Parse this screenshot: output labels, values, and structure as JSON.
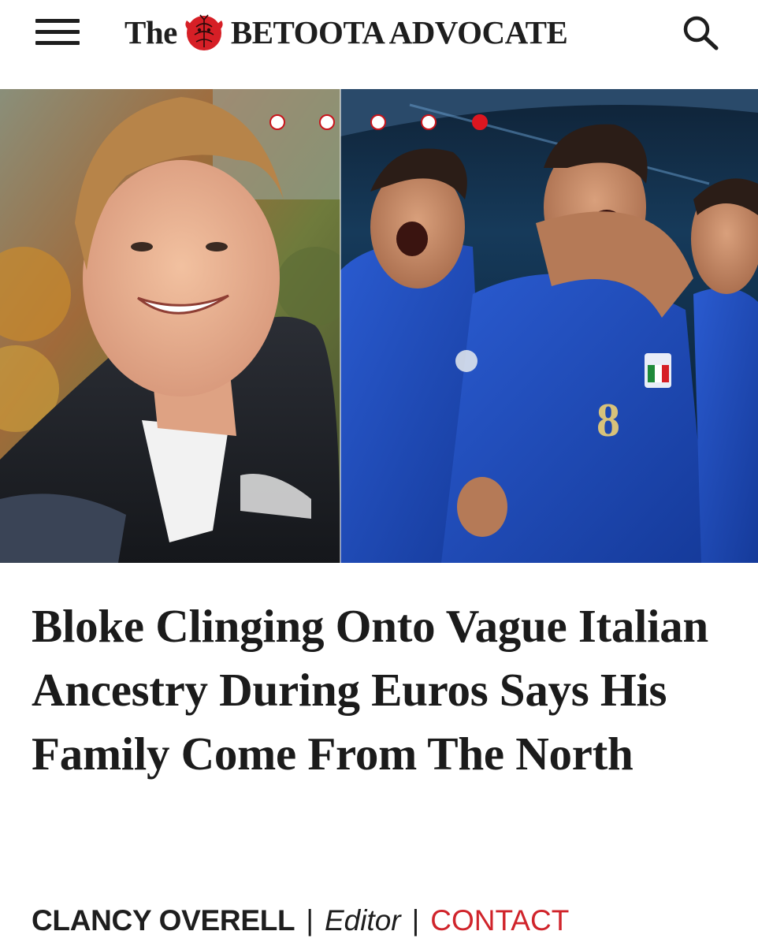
{
  "header": {
    "logo_prefix": "The",
    "logo_name": "BETOOTA ADVOCATE",
    "menu_icon": "hamburger-menu-icon",
    "search_icon": "search-icon",
    "emblem_icon": "red-crest-emblem-icon"
  },
  "hero": {
    "slides_total": 5,
    "active_slide": 5
  },
  "article": {
    "headline": "Bloke Clinging Onto Vague Italian Ancestry During Euros Says His Family Come From The North"
  },
  "byline": {
    "author": "CLANCY OVERELL",
    "separator": "|",
    "role": "Editor",
    "contact_label": "CONTACT"
  },
  "colors": {
    "accent_red": "#dd1620",
    "link_red": "#d0242b",
    "text_dark": "#1b1b1b"
  }
}
